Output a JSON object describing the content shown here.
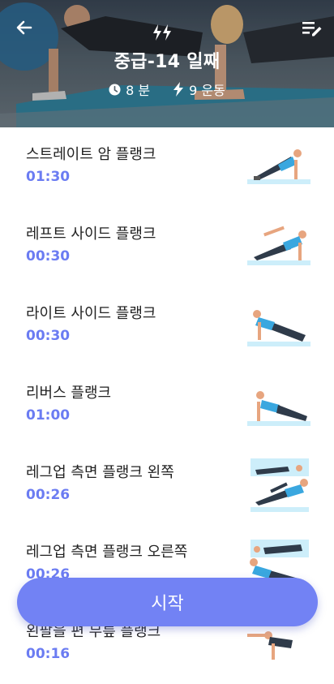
{
  "header": {
    "title": "중급-14 일째",
    "duration": "8 분",
    "exercise_count": "9 운동"
  },
  "exercises": [
    {
      "name": "스트레이트 암 플랭크",
      "duration": "01:30"
    },
    {
      "name": "레프트 사이드 플랭크",
      "duration": "00:30"
    },
    {
      "name": "라이트 사이드 플랭크",
      "duration": "00:30"
    },
    {
      "name": "리버스 플랭크",
      "duration": "01:00"
    },
    {
      "name": "레그업 측면 플랭크 왼쪽",
      "duration": "00:26"
    },
    {
      "name": "레그업 측면 플랭크 오른쪽",
      "duration": "00:26"
    },
    {
      "name": "왼팔을 편 무릎 플랭크",
      "duration": "00:16"
    }
  ],
  "start_button": "시작",
  "colors": {
    "accent": "#7282f4",
    "duration_text": "#6b7cf2"
  }
}
